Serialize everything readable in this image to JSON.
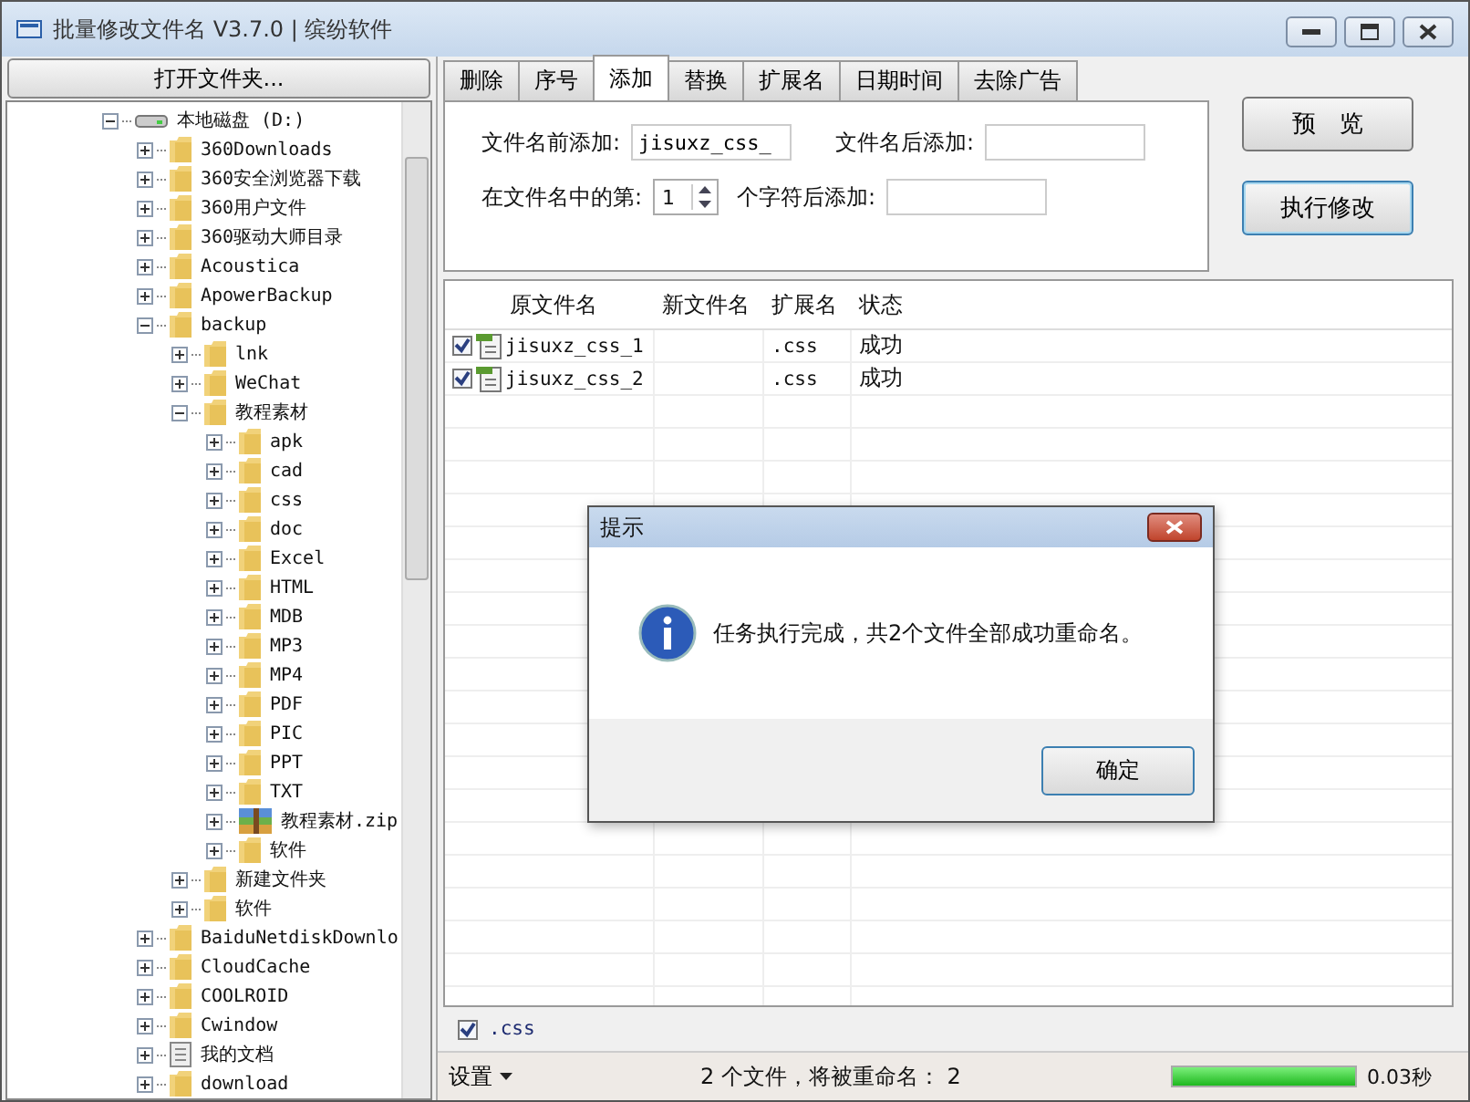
{
  "window": {
    "title": "批量修改文件名 V3.7.0 | 缤纷软件"
  },
  "open_folder_button": "打开文件夹...",
  "tree": [
    {
      "label": "本地磁盘 (D:)",
      "kind": "drive",
      "expanded": true,
      "children": [
        {
          "label": "360Downloads",
          "kind": "folder",
          "expanded": false
        },
        {
          "label": "360安全浏览器下载",
          "kind": "folder",
          "expanded": false
        },
        {
          "label": "360用户文件",
          "kind": "folder",
          "expanded": false
        },
        {
          "label": "360驱动大师目录",
          "kind": "folder",
          "expanded": false
        },
        {
          "label": "Acoustica",
          "kind": "folder",
          "expanded": false
        },
        {
          "label": "ApowerBackup",
          "kind": "folder",
          "expanded": false
        },
        {
          "label": "backup",
          "kind": "folder",
          "expanded": true,
          "children": [
            {
              "label": "lnk",
              "kind": "folder",
              "expanded": false
            },
            {
              "label": "WeChat",
              "kind": "folder",
              "expanded": false
            },
            {
              "label": "教程素材",
              "kind": "folder",
              "expanded": true,
              "children": [
                {
                  "label": "apk",
                  "kind": "folder",
                  "expanded": false
                },
                {
                  "label": "cad",
                  "kind": "folder",
                  "expanded": false
                },
                {
                  "label": "css",
                  "kind": "folder",
                  "expanded": false
                },
                {
                  "label": "doc",
                  "kind": "folder",
                  "expanded": false
                },
                {
                  "label": "Excel",
                  "kind": "folder",
                  "expanded": false
                },
                {
                  "label": "HTML",
                  "kind": "folder",
                  "expanded": false
                },
                {
                  "label": "MDB",
                  "kind": "folder",
                  "expanded": false
                },
                {
                  "label": "MP3",
                  "kind": "folder",
                  "expanded": false
                },
                {
                  "label": "MP4",
                  "kind": "folder",
                  "expanded": false
                },
                {
                  "label": "PDF",
                  "kind": "folder",
                  "expanded": false
                },
                {
                  "label": "PIC",
                  "kind": "folder",
                  "expanded": false
                },
                {
                  "label": "PPT",
                  "kind": "folder",
                  "expanded": false
                },
                {
                  "label": "TXT",
                  "kind": "folder",
                  "expanded": false
                },
                {
                  "label": "教程素材.zip",
                  "kind": "archive",
                  "expanded": false
                },
                {
                  "label": "软件",
                  "kind": "folder",
                  "expanded": false
                }
              ]
            },
            {
              "label": "新建文件夹",
              "kind": "folder",
              "expanded": false
            },
            {
              "label": "软件",
              "kind": "folder",
              "expanded": false
            }
          ]
        },
        {
          "label": "BaiduNetdiskDownlo",
          "kind": "folder",
          "expanded": false
        },
        {
          "label": "CloudCache",
          "kind": "folder",
          "expanded": false
        },
        {
          "label": "COOLROID",
          "kind": "folder",
          "expanded": false
        },
        {
          "label": "Cwindow",
          "kind": "folder",
          "expanded": false
        },
        {
          "label": "我的文档",
          "kind": "document",
          "expanded": false
        },
        {
          "label": "download",
          "kind": "folder",
          "expanded": false
        }
      ]
    }
  ],
  "tabs": [
    {
      "label": "删除",
      "selected": false
    },
    {
      "label": "序号",
      "selected": false
    },
    {
      "label": "添加",
      "selected": true
    },
    {
      "label": "替换",
      "selected": false
    },
    {
      "label": "扩展名",
      "selected": false
    },
    {
      "label": "日期时间",
      "selected": false
    },
    {
      "label": "去除广告",
      "selected": false
    }
  ],
  "form": {
    "prefix_label": "文件名前添加:",
    "prefix_value": "jisuxz_css_",
    "suffix_label": "文件名后添加:",
    "position_label": "在文件名中的第:",
    "position_value": "1",
    "insert_label": "个字符后添加:"
  },
  "buttons": [
    "预　览",
    "执行修改"
  ],
  "table": {
    "columns": [
      "原文件名",
      "新文件名",
      "扩展名",
      "状态"
    ],
    "rows": [
      {
        "checked": true,
        "name": "jisuxz_css_1",
        "ext": ".css",
        "status": "成功"
      },
      {
        "checked": true,
        "name": "jisuxz_css_2",
        "ext": ".css",
        "status": "成功"
      }
    ]
  },
  "filter": {
    "label": ".css",
    "checked": true
  },
  "status_bar": {
    "settings": "设置",
    "summary": "2 个文件，将被重命名： 2",
    "progress": {
      "level": 1
    },
    "time": "0.03秒"
  },
  "dialog": {
    "title": "提示",
    "message": "任务执行完成，共2个文件全部成功重命名。",
    "ok": "确定"
  }
}
